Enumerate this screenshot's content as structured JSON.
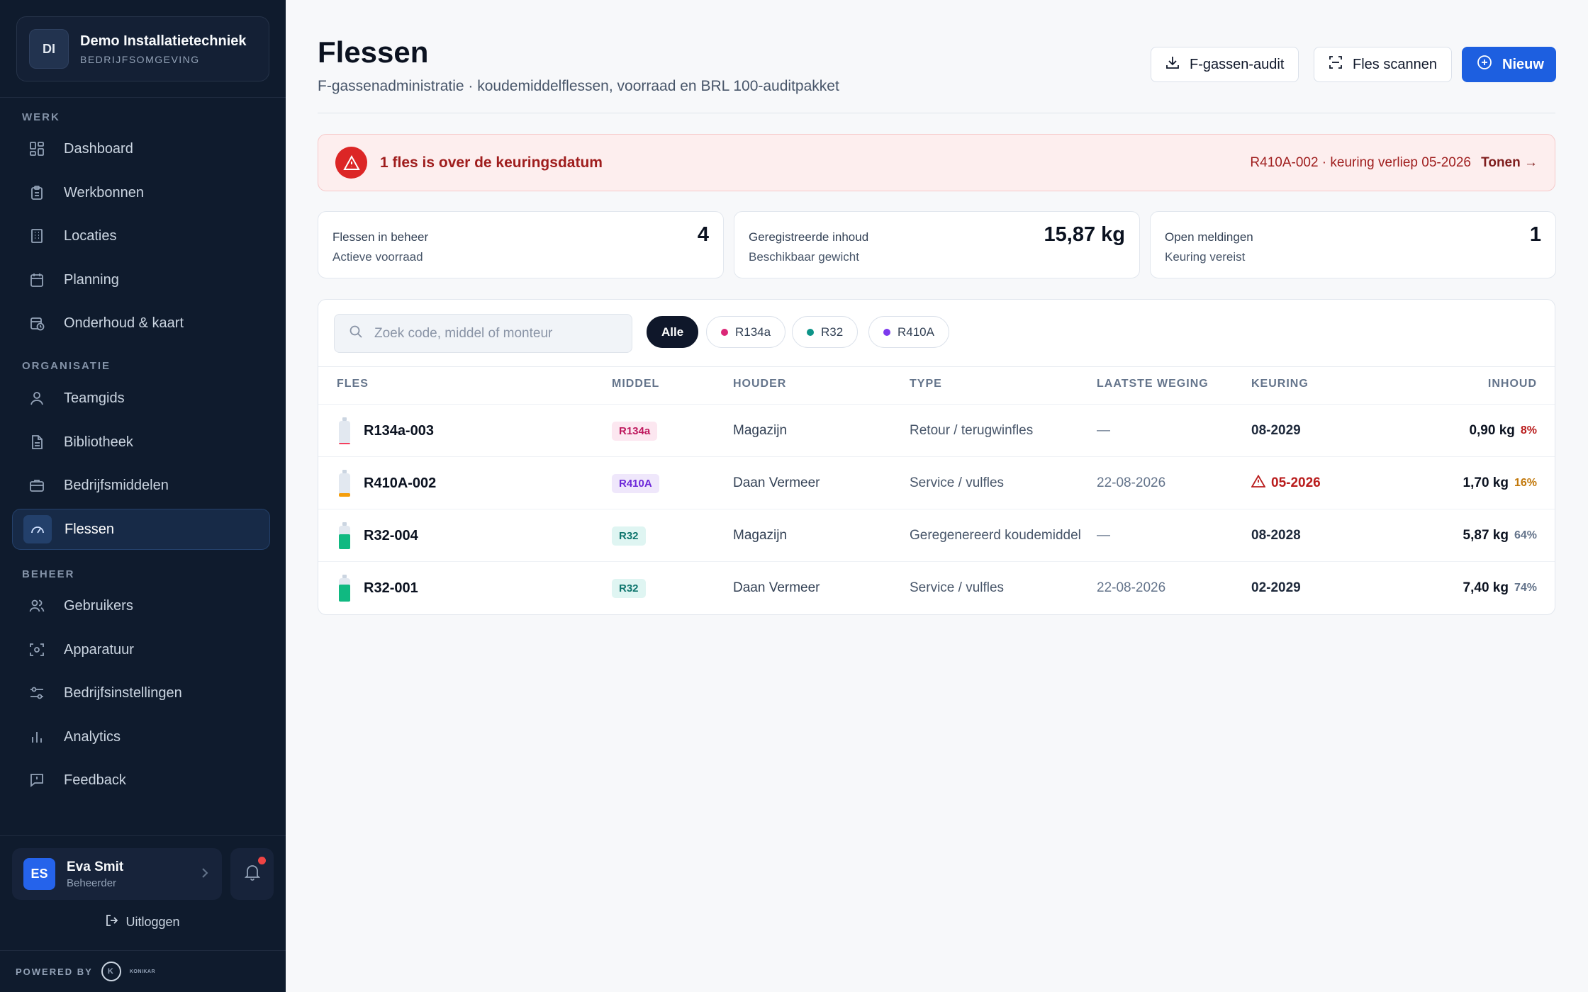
{
  "org": {
    "initials": "DI",
    "name": "Demo Installatietechniek",
    "sub": "BEDRIJFSOMGEVING"
  },
  "sidebar": {
    "sections": {
      "werk": "WERK",
      "organisatie": "ORGANISATIE",
      "beheer": "BEHEER"
    },
    "items": [
      {
        "label": "Dashboard",
        "icon": "dashboard-icon"
      },
      {
        "label": "Werkbonnen",
        "icon": "clipboard-icon"
      },
      {
        "label": "Locaties",
        "icon": "building-icon"
      },
      {
        "label": "Planning",
        "icon": "calendar-icon"
      },
      {
        "label": "Onderhoud & kaart",
        "icon": "calendar-clock-icon"
      },
      {
        "label": "Teamgids",
        "icon": "user-icon"
      },
      {
        "label": "Bibliotheek",
        "icon": "document-icon"
      },
      {
        "label": "Bedrijfsmiddelen",
        "icon": "briefcase-icon"
      },
      {
        "label": "Flessen",
        "icon": "gauge-icon"
      },
      {
        "label": "Gebruikers",
        "icon": "users-icon"
      },
      {
        "label": "Apparatuur",
        "icon": "scan-icon"
      },
      {
        "label": "Bedrijfsinstellingen",
        "icon": "sliders-icon"
      },
      {
        "label": "Analytics",
        "icon": "bar-chart-icon"
      },
      {
        "label": "Feedback",
        "icon": "message-icon"
      }
    ]
  },
  "user": {
    "initials": "ES",
    "name": "Eva Smit",
    "role": "Beheerder"
  },
  "logout_label": "Uitloggen",
  "powered_by": "POWERED BY",
  "powered_brand": "KONIKAR",
  "header": {
    "title": "Flessen",
    "subtitle": "F-gassenadministratie · koudemiddelflessen, voorraad en BRL 100-auditpakket",
    "audit_label": "F-gassen-audit",
    "scan_label": "Fles scannen",
    "new_label": "Nieuw"
  },
  "alert": {
    "title": "1 fles is over de keuringsdatum",
    "detail": "R410A-002 · keuring verliep 05-2026",
    "link": "Tonen →"
  },
  "stats": [
    {
      "label": "Flessen in beheer",
      "sub": "Actieve voorraad",
      "value": "4"
    },
    {
      "label": "Geregistreerde inhoud",
      "sub": "Beschikbaar gewicht",
      "value": "15,87 kg"
    },
    {
      "label": "Open meldingen",
      "sub": "Keuring vereist",
      "value": "1"
    }
  ],
  "search": {
    "placeholder": "Zoek code, middel of monteur",
    "value": ""
  },
  "filters": [
    {
      "label": "Alle",
      "color": ""
    },
    {
      "label": "R134a",
      "color": "#db2777"
    },
    {
      "label": "R32",
      "color": "#0d9488"
    },
    {
      "label": "R410A",
      "color": "#7c3aed"
    }
  ],
  "columns": [
    "FLES",
    "MIDDEL",
    "HOUDER",
    "TYPE",
    "LAATSTE WEGING",
    "KEURING",
    "INHOUD"
  ],
  "rows": [
    {
      "code": "R134a-003",
      "middel": "R134a",
      "houder": "Magazijn",
      "type": "Retour / terugwinfles",
      "weging": "—",
      "keuring": "08-2029",
      "inhoud": "0,90 kg",
      "pct": "8%",
      "pct_value": 8,
      "bottle_color": "#f43f5e",
      "warn": false
    },
    {
      "code": "R410A-002",
      "middel": "R410A",
      "houder": "Daan Vermeer",
      "type": "Service / vulfles",
      "weging": "22-08-2026",
      "keuring": "05-2026",
      "inhoud": "1,70 kg",
      "pct": "16%",
      "pct_value": 16,
      "bottle_color": "#f59e0b",
      "warn": true
    },
    {
      "code": "R32-004",
      "middel": "R32",
      "houder": "Magazijn",
      "type": "Geregenereerd koudemiddel",
      "weging": "—",
      "keuring": "08-2028",
      "inhoud": "5,87 kg",
      "pct": "64%",
      "pct_value": 64,
      "bottle_color": "#10b981",
      "warn": false
    },
    {
      "code": "R32-001",
      "middel": "R32",
      "houder": "Daan Vermeer",
      "type": "Service / vulfles",
      "weging": "22-08-2026",
      "keuring": "02-2029",
      "inhoud": "7,40 kg",
      "pct": "74%",
      "pct_value": 74,
      "bottle_color": "#10b981",
      "warn": false
    }
  ],
  "colors": {
    "accent": "#1d5fe0",
    "sidebar_bg": "#0f1b2d",
    "danger": "#b91c1c"
  }
}
